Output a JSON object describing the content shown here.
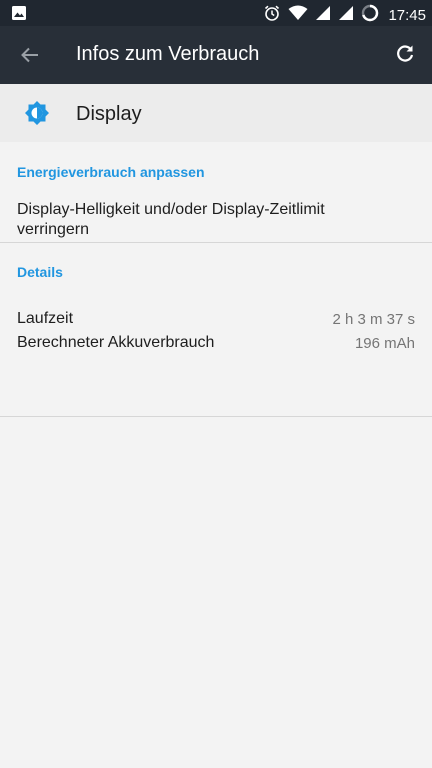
{
  "statusbar": {
    "time": "17:45",
    "icons": [
      "image-icon",
      "alarm-icon",
      "wifi-icon",
      "cell-signal-icon",
      "cell-signal-icon",
      "battery-ring-icon"
    ]
  },
  "toolbar": {
    "title": "Infos zum Verbrauch",
    "back_icon": "arrow-back-icon",
    "refresh_icon": "refresh-icon"
  },
  "app": {
    "name": "Display",
    "icon": "brightness-icon"
  },
  "sections": {
    "adjust": {
      "header": "Energieverbrauch anpassen",
      "suggestion": "Display-Helligkeit und/oder Display-Zeitlimit verringern"
    },
    "details": {
      "header": "Details",
      "rows": [
        {
          "label": "Laufzeit",
          "value": "2 h 3 m 37 s"
        },
        {
          "label": "Berechneter Akkuverbrauch",
          "value": "196 mAh"
        }
      ]
    }
  },
  "colors": {
    "statusbar_bg": "#202730",
    "toolbar_bg": "#282f38",
    "accent": "#2196e0",
    "background": "#f3f3f3"
  }
}
